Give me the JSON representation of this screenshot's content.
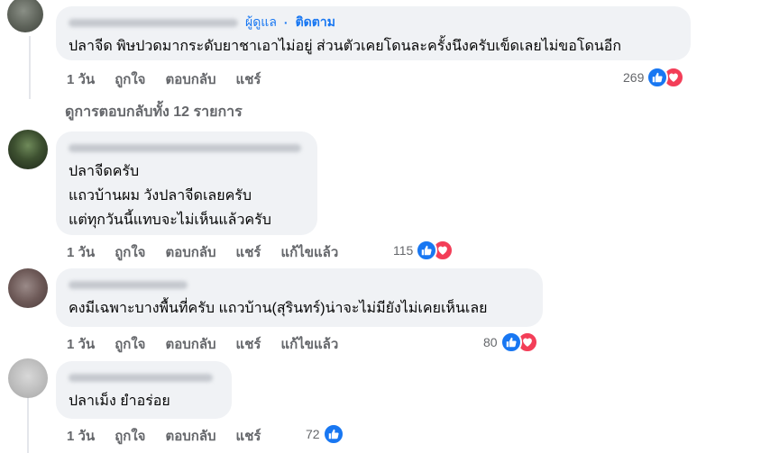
{
  "comments": [
    {
      "badge": "ผู้ดูแล",
      "follow": "ติดตาม",
      "lines": [
        "ปลาจีด พิษปวดมากระดับยาชาเอาไม่อยู่ ส่วนตัวเคยโดนละครั้งนึงครับเข็ดเลยไม่ขอโดนอีก"
      ],
      "time": "1 วัน",
      "like": "ถูกใจ",
      "reply": "ตอบกลับ",
      "share": "แชร์",
      "reactions": "269"
    },
    {
      "lines": [
        "ปลาจีดครับ",
        "แถวบ้านผม วังปลาจีดเลยครับ",
        "แต่ทุกวันนี้แทบจะไม่เห็นแล้วครับ"
      ],
      "time": "1 วัน",
      "like": "ถูกใจ",
      "reply": "ตอบกลับ",
      "share": "แชร์",
      "edited": "แก้ไขแล้ว",
      "reactions": "115"
    },
    {
      "lines": [
        "คงมีเฉพาะบางพื้นที่ครับ แถวบ้าน(สุรินทร์)น่าจะไม่มียังไม่เคยเห็นเลย"
      ],
      "time": "1 วัน",
      "like": "ถูกใจ",
      "reply": "ตอบกลับ",
      "share": "แชร์",
      "edited": "แก้ไขแล้ว",
      "reactions": "80"
    },
    {
      "lines": [
        "ปลาเม็ง ยำอร่อย"
      ],
      "time": "1 วัน",
      "like": "ถูกใจ",
      "reply": "ตอบกลับ",
      "share": "แชร์",
      "reactions": "72"
    }
  ],
  "view_replies": "ดูการตอบกลับทั้ง 12 รายการ",
  "colors": {
    "link": "#1877f2",
    "meta": "#65676b",
    "bubble": "#f0f2f5",
    "love": "#f33e58"
  },
  "icons": [
    "like-icon",
    "love-icon"
  ]
}
